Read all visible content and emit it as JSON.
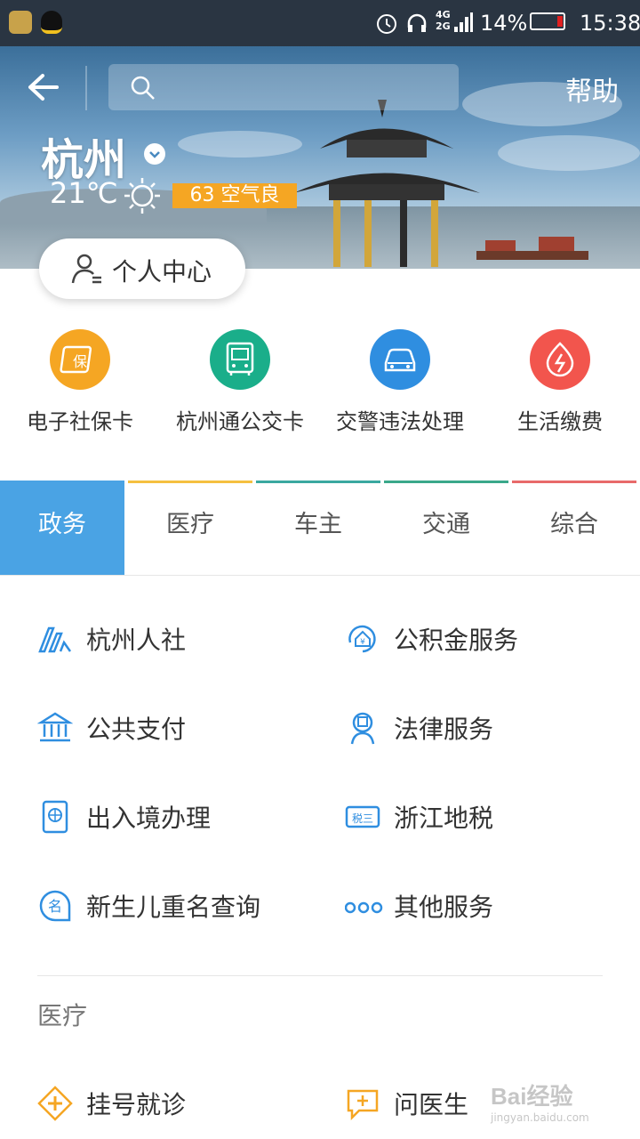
{
  "status_bar": {
    "network_top": "4G",
    "network_bottom": "2G",
    "battery": "14%",
    "time": "15:38"
  },
  "header": {
    "help": "帮助"
  },
  "city": {
    "name": "杭州",
    "temperature": "21℃",
    "air_quality": "63 空气良"
  },
  "user_center": {
    "label": "个人中心"
  },
  "quick_actions": [
    {
      "label": "电子社保卡",
      "icon": "social-card-icon",
      "color": "#f5a623"
    },
    {
      "label": "杭州通公交卡",
      "icon": "bus-card-icon",
      "color": "#1aae8a"
    },
    {
      "label": "交警违法处理",
      "icon": "car-icon",
      "color": "#2f8ee0"
    },
    {
      "label": "生活缴费",
      "icon": "utility-icon",
      "color": "#f2554d"
    }
  ],
  "tabs": [
    {
      "label": "政务",
      "active": true
    },
    {
      "label": "医疗"
    },
    {
      "label": "车主"
    },
    {
      "label": "交通"
    },
    {
      "label": "综合"
    }
  ],
  "services": [
    {
      "label": "杭州人社",
      "icon": "hr-icon"
    },
    {
      "label": "公积金服务",
      "icon": "fund-icon"
    },
    {
      "label": "公共支付",
      "icon": "bank-icon"
    },
    {
      "label": "法律服务",
      "icon": "law-icon"
    },
    {
      "label": "出入境办理",
      "icon": "passport-icon"
    },
    {
      "label": "浙江地税",
      "icon": "tax-icon"
    },
    {
      "label": "新生儿重名查询",
      "icon": "name-icon"
    },
    {
      "label": "其他服务",
      "icon": "more-icon"
    }
  ],
  "medical_section": {
    "title": "医疗",
    "items": [
      {
        "label": "挂号就诊",
        "icon": "register-icon"
      },
      {
        "label": "问医生",
        "icon": "ask-doctor-icon"
      }
    ]
  },
  "watermark": {
    "brand": "Bai经验",
    "url": "jingyan.baidu.com"
  },
  "colors": {
    "accent": "#4aa3e4",
    "banner_badge": "#f5a623"
  }
}
